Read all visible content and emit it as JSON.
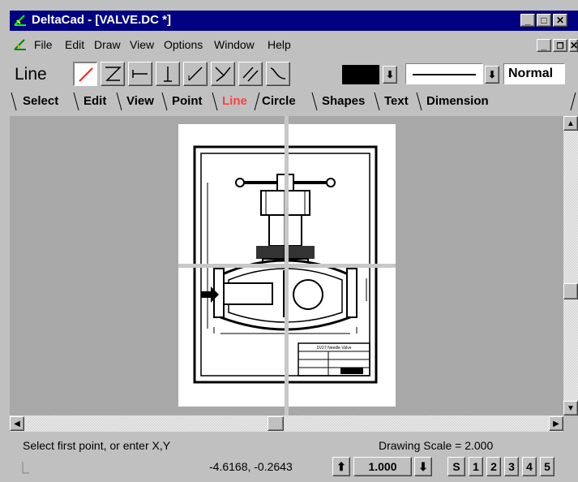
{
  "window": {
    "title": "DeltaCad - [VALVE.DC *]"
  },
  "menu": [
    "File",
    "Edit",
    "Draw",
    "View",
    "Options",
    "Window",
    "Help"
  ],
  "toolbar": {
    "mode_label": "Line",
    "tools": [
      "line-icon",
      "polyline-icon",
      "horizontal-line-icon",
      "vertical-line-icon",
      "angle-line-icon",
      "bisector-line-icon",
      "parallel-line-icon",
      "curve-icon"
    ],
    "color": "#000000",
    "line_style_value": "Normal"
  },
  "tabs": [
    "Select",
    "Edit",
    "View",
    "Point",
    "Line",
    "Circle",
    "Shapes",
    "Text",
    "Dimension"
  ],
  "active_tab": "Line",
  "drawing": {
    "title_block_text": "SV27 Needle Valve"
  },
  "status": {
    "prompt": "Select first point, or enter X,Y",
    "drawing_scale": "Drawing Scale = 2.000",
    "coordinates": "-4.6168, -0.2643",
    "scale_value": "1.000",
    "snap_buttons": [
      "S",
      "1",
      "2",
      "3",
      "4",
      "5"
    ]
  },
  "colors": {
    "titlebar": "#000080",
    "active_tab": "#ff4040",
    "canvas": "#a8a8a8"
  }
}
